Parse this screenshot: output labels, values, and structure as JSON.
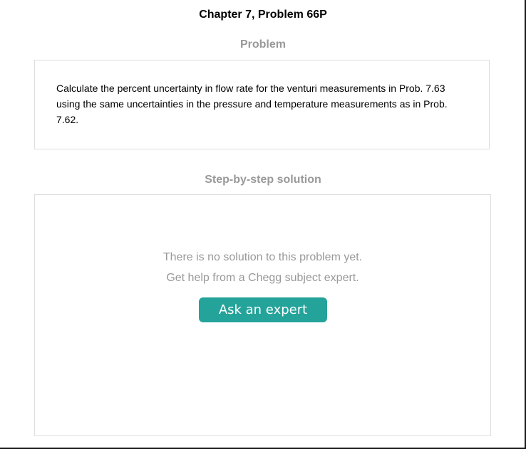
{
  "header": {
    "chapter_title": "Chapter 7, Problem 66P"
  },
  "problem": {
    "heading": "Problem",
    "text": "Calculate the percent uncertainty in flow rate for the venturi measurements in Prob. 7.63 using the same uncertainties in the pressure and temperature measurements as in Prob. 7.62."
  },
  "solution": {
    "heading": "Step-by-step solution",
    "no_solution_line1": "There is no solution to this problem yet.",
    "no_solution_line2": "Get help from a Chegg subject expert.",
    "ask_button_label": "Ask an expert"
  },
  "colors": {
    "accent": "#24a39a",
    "muted_text": "#999999",
    "border": "#dddddd"
  }
}
